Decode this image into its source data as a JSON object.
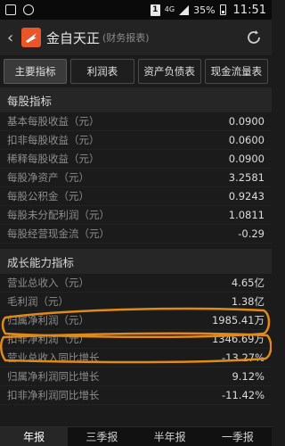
{
  "status_bar": {
    "sim": "1",
    "network": "4G",
    "battery": "35%",
    "time": "11:51",
    "icons": [
      "notification-icon",
      "message-icon"
    ]
  },
  "header": {
    "title": "金自天正",
    "subtitle": "(财务报表)",
    "back_icon": "chevron-left-icon",
    "refresh_icon": "refresh-icon"
  },
  "tabs": [
    {
      "label": "主要指标",
      "active": true
    },
    {
      "label": "利润表",
      "active": false
    },
    {
      "label": "资产负债表",
      "active": false
    },
    {
      "label": "现金流量表",
      "active": false
    }
  ],
  "sections": [
    {
      "title": "每股指标",
      "rows": [
        {
          "label": "基本每股收益（元）",
          "value": "0.0900"
        },
        {
          "label": "扣非每股收益（元）",
          "value": "0.0600"
        },
        {
          "label": "稀释每股收益（元）",
          "value": "0.0900"
        },
        {
          "label": "每股净资产（元）",
          "value": "3.2581"
        },
        {
          "label": "每股公积金（元）",
          "value": "0.9243"
        },
        {
          "label": "每股未分配利润（元）",
          "value": "1.0811"
        },
        {
          "label": "每股经营现金流（元）",
          "value": "-0.29"
        }
      ]
    },
    {
      "title": "成长能力指标",
      "rows": [
        {
          "label": "营业总收入（元）",
          "value": "4.65亿"
        },
        {
          "label": "毛利润（元）",
          "value": "1.38亿"
        },
        {
          "label": "归属净利润（元）",
          "value": "1985.41万"
        },
        {
          "label": "扣非净利润（元）",
          "value": "1346.69万"
        },
        {
          "label": "营业总收入同比增长",
          "value": "-13.27%"
        },
        {
          "label": "归属净利润同比增长",
          "value": "9.12%"
        },
        {
          "label": "扣非净利润同比增长",
          "value": "-11.42%"
        }
      ]
    }
  ],
  "bottom_tabs": [
    {
      "label": "年报",
      "active": true
    },
    {
      "label": "三季报",
      "active": false
    },
    {
      "label": "半年报",
      "active": false
    },
    {
      "label": "一季报",
      "active": false
    }
  ],
  "colors": {
    "background": "#1b1b1b",
    "logo": "#e8562a",
    "annotation": "#e08a1a"
  }
}
